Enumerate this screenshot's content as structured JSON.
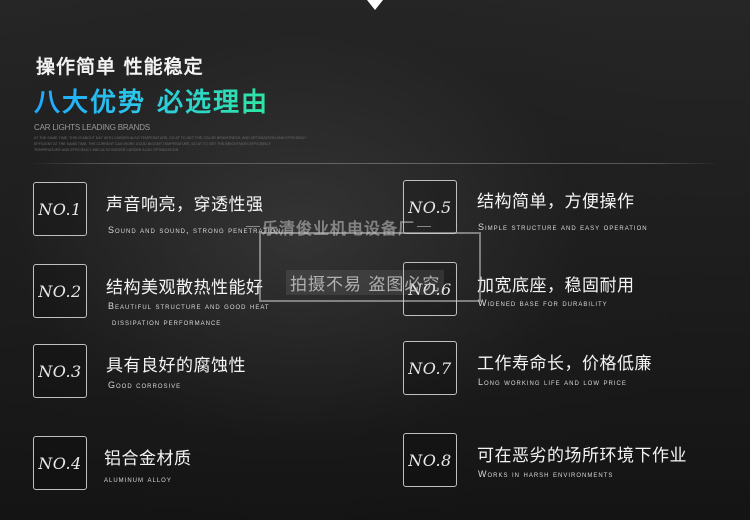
{
  "heading": {
    "line1": "操作简单 性能稳定",
    "line2": "八大优势 必选理由",
    "brand": "CAR LIGHTS LEADING BRANDS",
    "fine_print": [
      "AT THE SAME TIME, THIS IS ABOUT DAY WITH CARDER ALSO TEMPERATURE, DO AT TO GET THE COLOR BRIGHTNESS, AND OPTIMIZATION AND EFFICIENCY",
      "EFFICIENT AT THE SAME TIME, THE CURRENT CAN WORK GOOD BIGGER TEMPERATURE, DO AT TO GET THE BRIGHTNESS EFFICIENCY",
      "TEMPERATURE AND EFFICIENCY AND ALSO BIGGER CARDER ALSO OPTIMIZATION"
    ],
    "colors": {
      "gradient_start": "#1ea8ff",
      "gradient_end": "#2ee6a0"
    }
  },
  "features": [
    {
      "no": "NO.1",
      "title": "声音响亮，穿透性强",
      "sub": [
        "Sound and sound, strong penetration"
      ]
    },
    {
      "no": "NO.2",
      "title": "结构美观散热性能好",
      "sub": [
        "Beautiful structure and good heat",
        "dissipation performance"
      ]
    },
    {
      "no": "NO.3",
      "title": "具有良好的腐蚀性",
      "sub": [
        "Good corrosive"
      ]
    },
    {
      "no": "NO.4",
      "title": "铝合金材质",
      "sub": [
        "aluminum alloy"
      ]
    },
    {
      "no": "NO.5",
      "title": "结构简单，方便操作",
      "sub": [
        "Simple structure and easy operation"
      ]
    },
    {
      "no": "NO.6",
      "title": "加宽底座，稳固耐用",
      "sub": [
        "Widened base for durability"
      ]
    },
    {
      "no": "NO.7",
      "title": "工作寿命长，价格低廉",
      "sub": [
        "Long working life and low price"
      ]
    },
    {
      "no": "NO.8",
      "title": "可在恶劣的场所环境下作业",
      "sub": [
        "Works in harsh environments"
      ]
    }
  ],
  "watermark": {
    "company": "乐清俊业机电设备厂",
    "notice": "拍摄不易  盗图必究"
  },
  "icons": {
    "top_notch": "chevron-down-icon"
  }
}
